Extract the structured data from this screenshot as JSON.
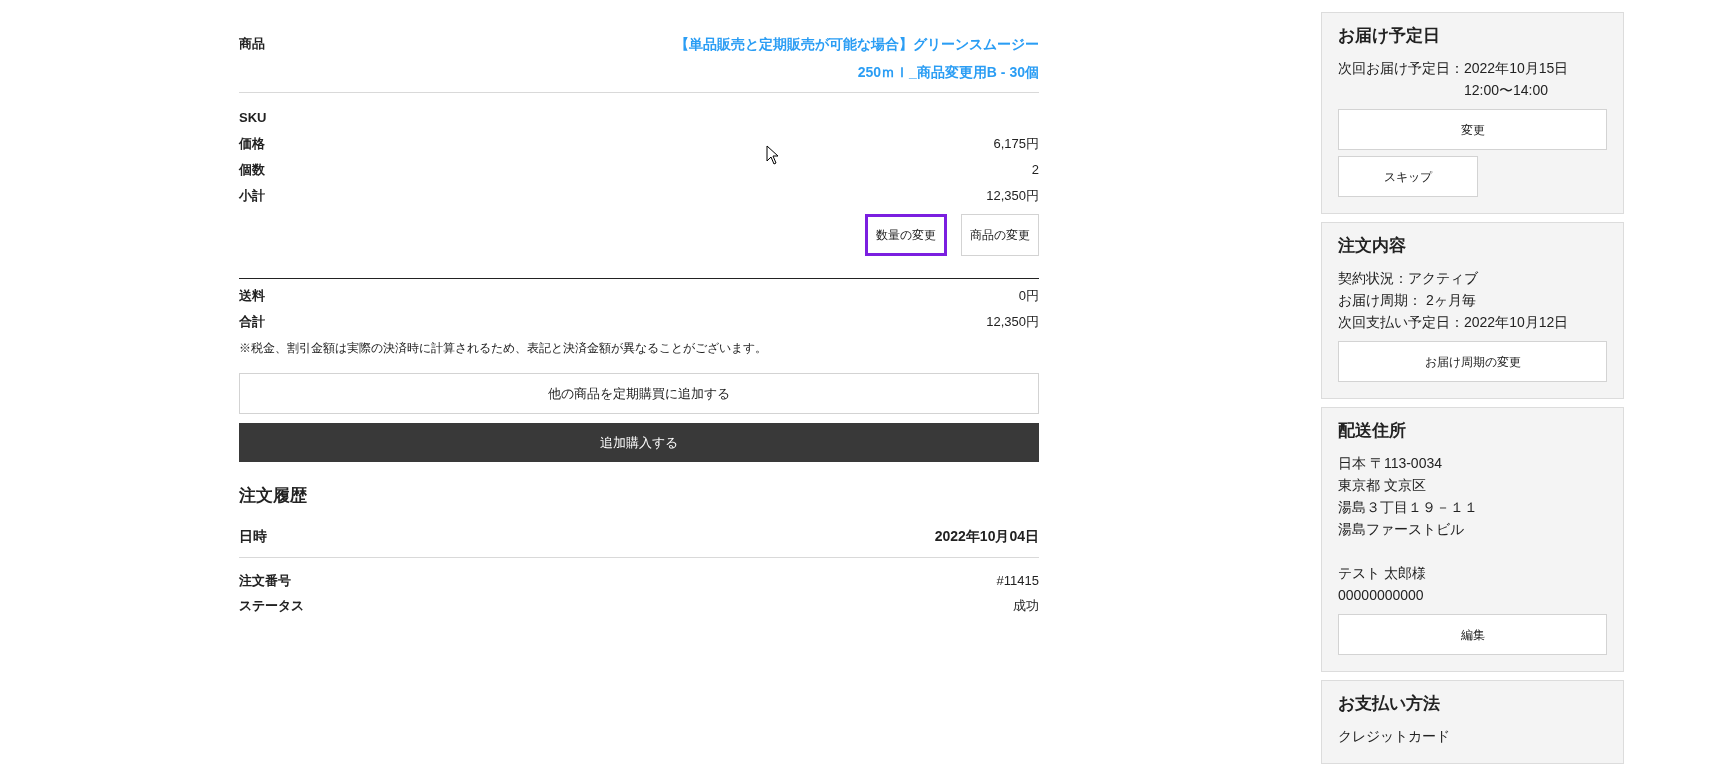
{
  "product": {
    "label": "商品",
    "name_lines": [
      "【単品販売と定期販売が可能な場合】グリーンスムージー",
      "250ｍｌ_商品変更用B - 30個"
    ]
  },
  "details": [
    {
      "label": "SKU"
    },
    {
      "label": "価格",
      "value": "6,175円"
    },
    {
      "label": "個数",
      "value": "2"
    },
    {
      "label": "小計",
      "value": "12,350円"
    }
  ],
  "item_buttons": [
    {
      "label": "数量の変更",
      "focused": true
    },
    {
      "label": "商品の変更",
      "focused": false
    }
  ],
  "totals": [
    {
      "label": "送料",
      "value": "0円"
    },
    {
      "label": "合計",
      "value": "12,350円"
    }
  ],
  "note": "※税金、割引金額は実際の決済時に計算されるため、表記と決済金額が異なることがございます。",
  "actions": [
    {
      "label": "他の商品を定期購買に追加する",
      "kind": "outline"
    },
    {
      "label": "追加購入する",
      "kind": "dark"
    }
  ],
  "history": {
    "title": "注文履歴",
    "date_label": "日時",
    "date_value": "2022年10月04日",
    "rows": [
      {
        "label": "注文番号",
        "value": "#11415"
      },
      {
        "label": "ステータス",
        "value": "成功"
      }
    ]
  },
  "sidebar": [
    {
      "title": "お届け予定日",
      "lines": [
        {
          "label": "次回お届け予定日：",
          "value": "2022年10月15日",
          "extra": "12:00〜14:00"
        }
      ],
      "buttons": [
        {
          "label": "変更",
          "kind": "full"
        },
        {
          "label": "スキップ",
          "kind": "half"
        }
      ]
    },
    {
      "title": "注文内容",
      "lines": [
        {
          "label": "契約状況：",
          "value": "アクティブ"
        },
        {
          "label": "お届け周期：",
          "value": " 2ヶ月毎"
        },
        {
          "label": "次回支払い予定日：",
          "value": "2022年10月12日"
        }
      ],
      "buttons": [
        {
          "label": "お届け周期の変更",
          "kind": "full"
        }
      ]
    },
    {
      "title": "配送住所",
      "blocks": [
        [
          "日本 〒113-0034",
          "東京都 文京区",
          "湯島３丁目１９－１１",
          "湯島ファーストビル"
        ],
        [
          "テスト 太郎様",
          "00000000000"
        ]
      ],
      "buttons": [
        {
          "label": "編集",
          "kind": "full"
        }
      ]
    },
    {
      "title": "お支払い方法",
      "lines": [
        {
          "label": "クレジットカード"
        }
      ]
    }
  ]
}
